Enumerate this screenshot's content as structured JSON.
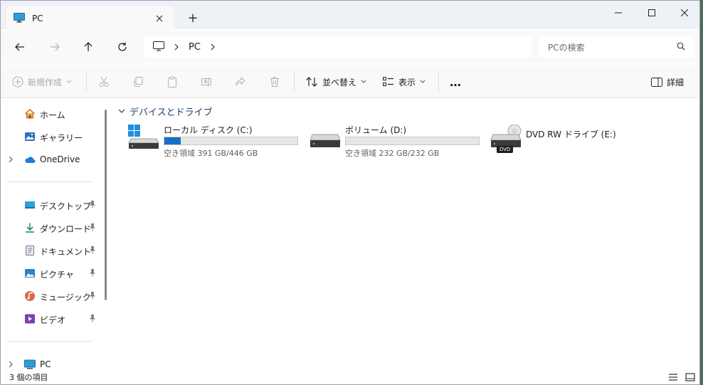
{
  "window": {
    "tab_title": "PC",
    "new_tab_symbol": "+"
  },
  "address": {
    "breadcrumb": "PC",
    "search_placeholder": "PCの検索"
  },
  "commands": {
    "new": "新規作成",
    "sort": "並べ替え",
    "view": "表示",
    "more": "…",
    "details": "詳細"
  },
  "sidebar": {
    "top": [
      {
        "label": "ホーム",
        "icon": "home-icon"
      },
      {
        "label": "ギャラリー",
        "icon": "gallery-icon"
      },
      {
        "label": "OneDrive",
        "icon": "onedrive-icon"
      }
    ],
    "quick_access": [
      {
        "label": "デスクトップ",
        "icon": "desktop-icon"
      },
      {
        "label": "ダウンロード",
        "icon": "download-icon"
      },
      {
        "label": "ドキュメント",
        "icon": "documents-icon"
      },
      {
        "label": "ピクチャ",
        "icon": "pictures-icon"
      },
      {
        "label": "ミュージック",
        "icon": "music-icon"
      },
      {
        "label": "ビデオ",
        "icon": "video-icon"
      }
    ],
    "bottom": [
      {
        "label": "PC",
        "icon": "pc-icon"
      }
    ]
  },
  "content": {
    "group_title": "デバイスとドライブ",
    "drives": [
      {
        "name": "ローカル ディスク (C:)",
        "free": "空き領域 391 GB/446 GB",
        "used_fraction": 0.123
      },
      {
        "name": "ボリューム (D:)",
        "free": "空き領域 232 GB/232 GB",
        "used_fraction": 0.0
      },
      {
        "name": "DVD RW ドライブ (E:)",
        "badge": "DVD"
      }
    ]
  },
  "status": {
    "item_count": "3 個の項目"
  },
  "colors": {
    "accent": "#1a6fc4",
    "titlebar": "#eef1f5",
    "toolbar": "#f9f9f9"
  }
}
